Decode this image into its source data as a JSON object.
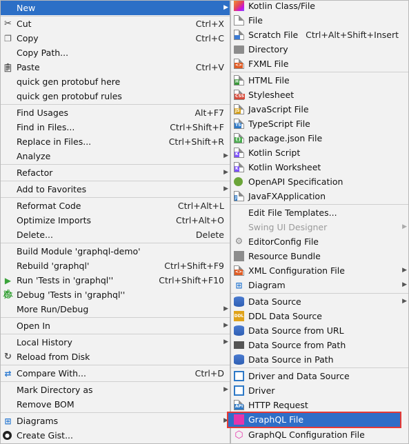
{
  "left_menu": {
    "items": [
      {
        "label": "New",
        "shortcut": "",
        "submenu": true
      },
      {
        "label": "Cut",
        "shortcut": "Ctrl+X",
        "icon": "scissors-icon"
      },
      {
        "label": "Copy",
        "shortcut": "Ctrl+C",
        "icon": "copy-icon"
      },
      {
        "label": "Copy Path...",
        "shortcut": ""
      },
      {
        "label": "Paste",
        "shortcut": "Ctrl+V",
        "icon": "paste-icon"
      },
      {
        "label": "quick gen protobuf here",
        "shortcut": ""
      },
      {
        "label": "quick gen protobuf rules",
        "shortcut": ""
      },
      {
        "label": "Find Usages",
        "shortcut": "Alt+F7"
      },
      {
        "label": "Find in Files...",
        "shortcut": "Ctrl+Shift+F"
      },
      {
        "label": "Replace in Files...",
        "shortcut": "Ctrl+Shift+R"
      },
      {
        "label": "Analyze",
        "shortcut": "",
        "submenu": true
      },
      {
        "label": "Refactor",
        "shortcut": "",
        "submenu": true
      },
      {
        "label": "Add to Favorites",
        "shortcut": "",
        "submenu": true
      },
      {
        "label": "Reformat Code",
        "shortcut": "Ctrl+Alt+L"
      },
      {
        "label": "Optimize Imports",
        "shortcut": "Ctrl+Alt+O"
      },
      {
        "label": "Delete...",
        "shortcut": "Delete"
      },
      {
        "label": "Build Module 'graphql-demo'",
        "shortcut": ""
      },
      {
        "label": "Rebuild 'graphql'",
        "shortcut": "Ctrl+Shift+F9"
      },
      {
        "label": "Run 'Tests in 'graphql''",
        "shortcut": "Ctrl+Shift+F10",
        "icon": "run-icon"
      },
      {
        "label": "Debug 'Tests in 'graphql''",
        "shortcut": "",
        "icon": "debug-icon"
      },
      {
        "label": "More Run/Debug",
        "shortcut": "",
        "submenu": true
      },
      {
        "label": "Open In",
        "shortcut": "",
        "submenu": true
      },
      {
        "label": "Local History",
        "shortcut": "",
        "submenu": true
      },
      {
        "label": "Reload from Disk",
        "shortcut": "",
        "icon": "reload-icon"
      },
      {
        "label": "Compare With...",
        "shortcut": "Ctrl+D",
        "icon": "compare-icon"
      },
      {
        "label": "Mark Directory as",
        "shortcut": "",
        "submenu": true
      },
      {
        "label": "Remove BOM",
        "shortcut": ""
      },
      {
        "label": "Diagrams",
        "shortcut": "",
        "submenu": true,
        "icon": "diagram-icon"
      },
      {
        "label": "Create Gist...",
        "shortcut": "",
        "icon": "github-icon"
      }
    ]
  },
  "right_menu": {
    "items": [
      {
        "label": "Kotlin Class/File",
        "icon": "kotlin-icon"
      },
      {
        "label": "File",
        "icon": "file-icon"
      },
      {
        "label": "Scratch File",
        "shortcut": "Ctrl+Alt+Shift+Insert",
        "icon": "scratch-file-icon"
      },
      {
        "label": "Directory",
        "icon": "folder-icon"
      },
      {
        "label": "FXML File",
        "icon": "fxml-file-icon"
      },
      {
        "label": "HTML File",
        "icon": "html-file-icon"
      },
      {
        "label": "Stylesheet",
        "icon": "css-file-icon"
      },
      {
        "label": "JavaScript File",
        "icon": "js-file-icon"
      },
      {
        "label": "TypeScript File",
        "icon": "ts-file-icon"
      },
      {
        "label": "package.json File",
        "icon": "json-file-icon"
      },
      {
        "label": "Kotlin Script",
        "icon": "kotlin-script-icon"
      },
      {
        "label": "Kotlin Worksheet",
        "icon": "kotlin-worksheet-icon"
      },
      {
        "label": "OpenAPI Specification",
        "icon": "openapi-icon"
      },
      {
        "label": "JavaFXApplication",
        "icon": "javafx-icon"
      },
      {
        "label": "Edit File Templates...",
        "icon": ""
      },
      {
        "label": "Swing UI Designer",
        "icon": "",
        "disabled": true,
        "submenu": true
      },
      {
        "label": "EditorConfig File",
        "icon": "editorconfig-icon"
      },
      {
        "label": "Resource Bundle",
        "icon": "resource-bundle-icon"
      },
      {
        "label": "XML Configuration File",
        "icon": "xml-file-icon",
        "submenu": true
      },
      {
        "label": "Diagram",
        "icon": "diagram-icon",
        "submenu": true
      },
      {
        "label": "Data Source",
        "icon": "database-icon",
        "submenu": true
      },
      {
        "label": "DDL Data Source",
        "icon": "ddl-icon"
      },
      {
        "label": "Data Source from URL",
        "icon": "database-url-icon"
      },
      {
        "label": "Data Source from Path",
        "icon": "folder-open-icon"
      },
      {
        "label": "Data Source in Path",
        "icon": "database-path-icon"
      },
      {
        "label": "Driver and Data Source",
        "icon": "driver-datasource-icon"
      },
      {
        "label": "Driver",
        "icon": "driver-icon"
      },
      {
        "label": "HTTP Request",
        "icon": "api-icon"
      },
      {
        "label": "GraphQL File",
        "icon": "graphql-file-icon",
        "highlighted": true
      },
      {
        "label": "GraphQL Configuration File",
        "icon": "graphql-config-icon"
      }
    ]
  },
  "colors": {
    "active_bg": "#2c6fc6",
    "highlight_border": "#e53935",
    "menu_bg": "#f2f2f2"
  }
}
